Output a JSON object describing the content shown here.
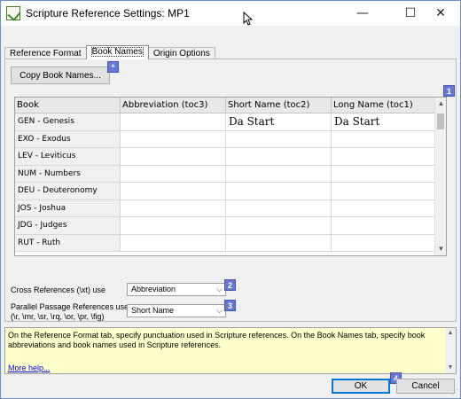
{
  "window": {
    "title": "Scripture Reference Settings: MP1",
    "minimize_glyph": "—",
    "maximize_glyph": "☐",
    "close_glyph": "✕"
  },
  "tabs": [
    {
      "label": "Reference Format",
      "active": false
    },
    {
      "label": "Book Names",
      "active": true
    },
    {
      "label": "Origin Options",
      "active": false
    }
  ],
  "book_names": {
    "copy_button_label": "Copy Book Names...",
    "columns": [
      "Book",
      "Abbreviation (toc3)",
      "Short Name (toc2)",
      "Long Name (toc1)"
    ],
    "rows": [
      {
        "book": "GEN - Genesis",
        "abbreviation": "",
        "short_name": "Da Start",
        "long_name": "Da Start"
      },
      {
        "book": "EXO - Exodus",
        "abbreviation": "",
        "short_name": "",
        "long_name": ""
      },
      {
        "book": "LEV - Leviticus",
        "abbreviation": "",
        "short_name": "",
        "long_name": ""
      },
      {
        "book": "NUM - Numbers",
        "abbreviation": "",
        "short_name": "",
        "long_name": ""
      },
      {
        "book": "DEU - Deuteronomy",
        "abbreviation": "",
        "short_name": "",
        "long_name": ""
      },
      {
        "book": "JOS - Joshua",
        "abbreviation": "",
        "short_name": "",
        "long_name": ""
      },
      {
        "book": "JDG - Judges",
        "abbreviation": "",
        "short_name": "",
        "long_name": ""
      },
      {
        "book": "RUT - Ruth",
        "abbreviation": "",
        "short_name": "",
        "long_name": ""
      }
    ]
  },
  "options": {
    "cross_ref_label": "Cross References (\\xt) use",
    "cross_ref_value": "Abbreviation",
    "parallel_label_line1": "Parallel Passage References use",
    "parallel_label_line2": "(\\r, \\mr, \\sr, \\rq, \\or, \\pr, \\fig)",
    "parallel_value": "Short Name"
  },
  "badges": [
    "*",
    "1",
    "2",
    "3",
    "4"
  ],
  "help": {
    "text": "On the Reference Format tab, specify punctuation used in Scripture references. On the Book Names tab, specify book abbreviations and book names used in Scripture references.",
    "more_help": "More help..."
  },
  "buttons": {
    "ok": "OK",
    "cancel": "Cancel"
  },
  "colors": {
    "badge": "#6678d4",
    "help_background": "#ffffcc",
    "window_border": "#6b8fc7"
  }
}
